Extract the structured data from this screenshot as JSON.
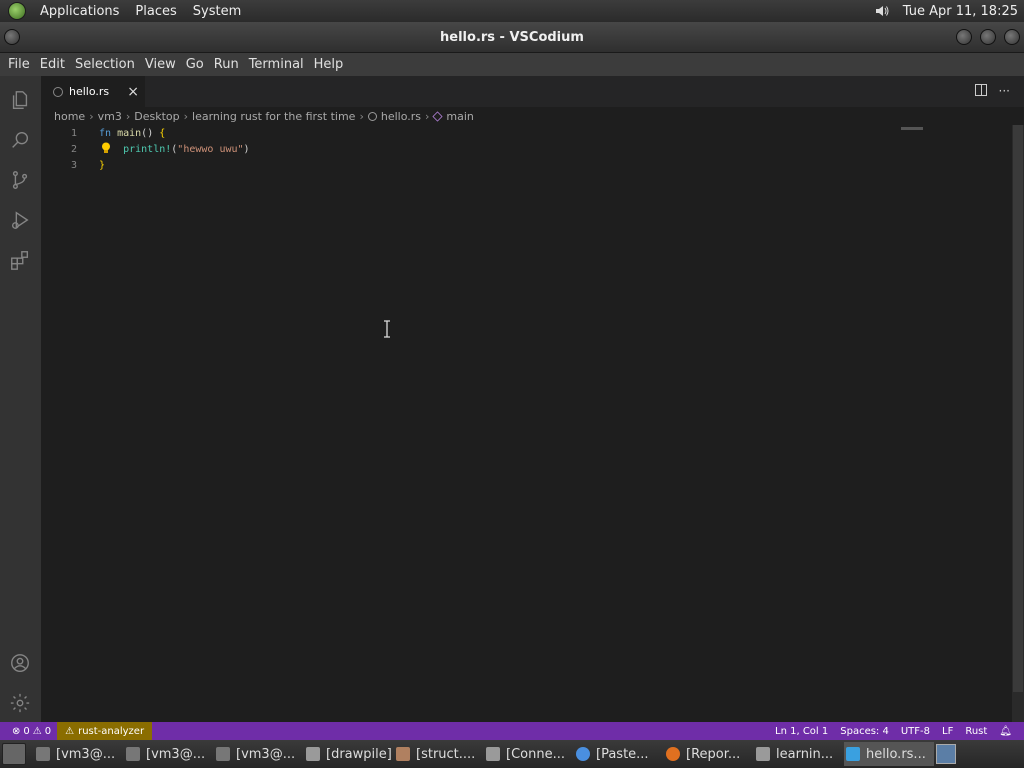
{
  "top_panel": {
    "menus": [
      "Applications",
      "Places",
      "System"
    ],
    "clock": "Tue Apr 11, 18:25"
  },
  "window": {
    "title": "hello.rs - VSCodium"
  },
  "menubar": [
    "File",
    "Edit",
    "Selection",
    "View",
    "Go",
    "Run",
    "Terminal",
    "Help"
  ],
  "tab": {
    "label": "hello.rs",
    "close": "×"
  },
  "tab_actions": {
    "more": "···"
  },
  "breadcrumbs": [
    "home",
    "vm3",
    "Desktop",
    "learning rust for the first time",
    "hello.rs",
    "main"
  ],
  "editor": {
    "lines": [
      {
        "num": "1",
        "tokens": [
          {
            "t": "fn",
            "c": "kw"
          },
          {
            "t": " ",
            "c": "plain"
          },
          {
            "t": "main",
            "c": "fn"
          },
          {
            "t": "() ",
            "c": "plain"
          },
          {
            "t": "{",
            "c": "punc"
          }
        ]
      },
      {
        "num": "2",
        "tokens": [
          {
            "t": "    ",
            "c": "plain"
          },
          {
            "t": "println!",
            "c": "mac"
          },
          {
            "t": "(",
            "c": "plain"
          },
          {
            "t": "\"hewwo uwu\"",
            "c": "str"
          },
          {
            "t": ")",
            "c": "plain"
          }
        ]
      },
      {
        "num": "3",
        "tokens": [
          {
            "t": "}",
            "c": "punc"
          }
        ]
      }
    ]
  },
  "statusbar": {
    "errors": "0",
    "warnings": "0",
    "rust_analyzer": "rust-analyzer",
    "position": "Ln 1, Col 1",
    "spaces": "Spaces: 4",
    "encoding": "UTF-8",
    "eol": "LF",
    "language": "Rust"
  },
  "taskbar": {
    "items": [
      {
        "label": "[vm3@...",
        "icon": "terminal-icon"
      },
      {
        "label": "[vm3@...",
        "icon": "terminal-icon"
      },
      {
        "label": "[vm3@...",
        "icon": "terminal-icon"
      },
      {
        "label": "[drawpile]",
        "icon": "folder-icon"
      },
      {
        "label": "[struct....",
        "icon": "editor-icon"
      },
      {
        "label": "[Conne...",
        "icon": "folder-icon"
      },
      {
        "label": "[Paste...",
        "icon": "chromium-icon"
      },
      {
        "label": "[Repor...",
        "icon": "firefox-icon"
      },
      {
        "label": "learnin...",
        "icon": "folder-icon"
      },
      {
        "label": "hello.rs...",
        "icon": "vscodium-icon"
      }
    ]
  },
  "colors": {
    "statusbar": "#6f2da8",
    "warning_badge": "#8a6d00"
  }
}
